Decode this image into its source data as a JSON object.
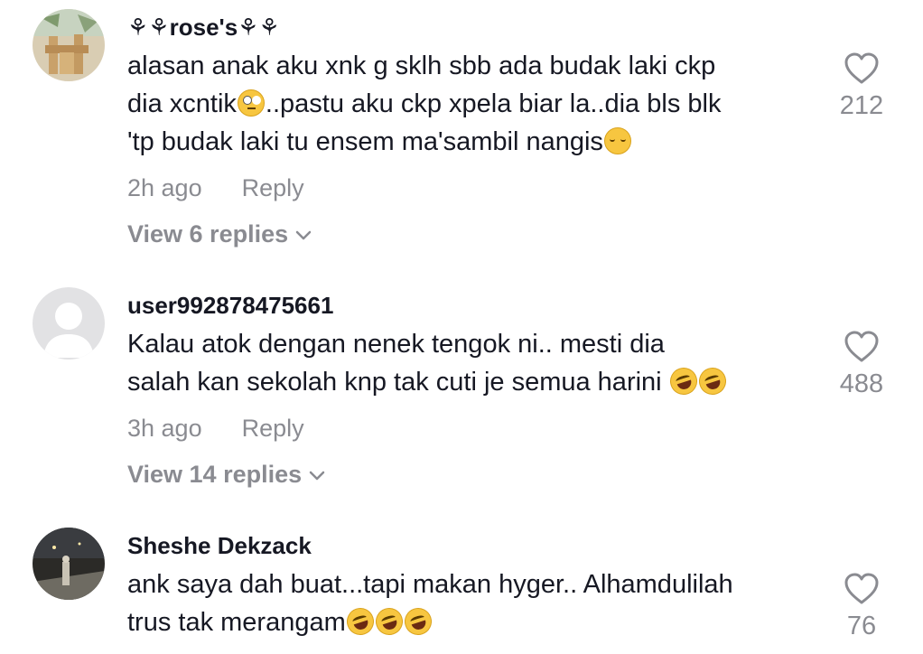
{
  "comments": [
    {
      "username": "⚘⚘rose's⚘⚘",
      "lines": [
        "alasan anak aku xnk g sklh sbb ada budak laki ckp",
        "dia xcntik",
        "..pastu aku ckp xpela biar la..dia bls blk",
        "'tp budak laki tu ensem ma'sambil nangis"
      ],
      "emojis": [
        "face-with-rolling-eyes",
        "relieved-face"
      ],
      "time": "2h ago",
      "reply_label": "Reply",
      "view_replies": "View 6 replies",
      "likes": "212"
    },
    {
      "username": "user992878475661",
      "lines": [
        "Kalau atok dengan nenek tengok ni.. mesti dia",
        "salah kan sekolah knp tak cuti je semua harini "
      ],
      "emojis": [
        "rolling-on-floor-laughing",
        "rolling-on-floor-laughing"
      ],
      "time": "3h ago",
      "reply_label": "Reply",
      "view_replies": "View 14 replies",
      "likes": "488"
    },
    {
      "username": "Sheshe Dekzack",
      "lines": [
        "ank saya dah buat...tapi makan hyger.. Alhamdulilah",
        "trus tak merangam"
      ],
      "emojis": [
        "rolling-on-floor-laughing",
        "rolling-on-floor-laughing",
        "rolling-on-floor-laughing"
      ],
      "likes": "76"
    }
  ],
  "colors": {
    "text": "#161823",
    "muted": "#8a8b91",
    "emoji": "#f7c640"
  },
  "icons": {
    "like": "heart-outline-icon",
    "expand": "chevron-down-icon"
  }
}
